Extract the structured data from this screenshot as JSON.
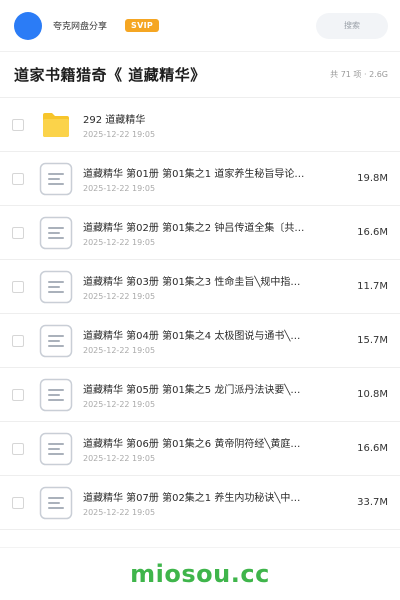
{
  "header": {
    "share_name": "夸克网盘分享",
    "badge": "SVIP",
    "search_placeholder": "搜索"
  },
  "title_bar": {
    "title": "道家书籍猎奇《 道藏精华》",
    "meta": "共 71 项 · 2.6G"
  },
  "files": [
    {
      "type": "folder",
      "name": "292 道藏精华",
      "date": "2025-12-22 19:05",
      "size": ""
    },
    {
      "type": "document",
      "name": "道藏精华 第01册 第01集之1 道家养生秘旨导论…",
      "date": "2025-12-22 19:05",
      "size": "19.8M"
    },
    {
      "type": "document",
      "name": "道藏精华 第02册 第01集之2 钟吕传道全集〔共…",
      "date": "2025-12-22 19:05",
      "size": "16.6M"
    },
    {
      "type": "document",
      "name": "道藏精华 第03册 第01集之3 性命圭旨╲规中指…",
      "date": "2025-12-22 19:05",
      "size": "11.7M"
    },
    {
      "type": "document",
      "name": "道藏精华 第04册 第01集之4 太极图说与通书╲…",
      "date": "2025-12-22 19:05",
      "size": "15.7M"
    },
    {
      "type": "document",
      "name": "道藏精华 第05册 第01集之5 龙门派丹法诀要╲…",
      "date": "2025-12-22 19:05",
      "size": "10.8M"
    },
    {
      "type": "document",
      "name": "道藏精华 第06册 第01集之6 黄帝阴符经╲黄庭…",
      "date": "2025-12-22 19:05",
      "size": "16.6M"
    },
    {
      "type": "document",
      "name": "道藏精华 第07册 第02集之1 养生内功秘诀╲中…",
      "date": "2025-12-22 19:05",
      "size": "33.7M"
    }
  ],
  "footer": {
    "brand": "miosou.cc"
  },
  "colors": {
    "avatar": "#2b7cf6",
    "badge": "#f5a623",
    "folder": "#f7c52b",
    "brand": "#3fb54b"
  }
}
